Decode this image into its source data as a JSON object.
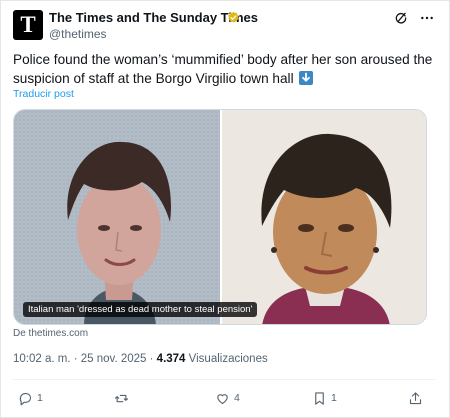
{
  "author": {
    "avatar_letter": "T",
    "name": "The Times and The Sunday Times",
    "handle": "@thetimes",
    "verified_color": "#e2b719"
  },
  "tweet": {
    "text": "Police found the woman’s ‘mummified’ body after her son aroused the suspicion of staff at the Borgo Virgilio town hall",
    "emoji": "down-arrow-emoji",
    "translate_label": "Traducir post"
  },
  "media": {
    "caption": "Italian man 'dressed as dead mother to steal pension'",
    "source": "De thetimes.com",
    "left_photo": "woman-passport-photo",
    "right_photo": "man-in-disguise-photo"
  },
  "meta": {
    "time": "10:02 a. m.",
    "date": "25 nov. 2025",
    "views": "4.374",
    "views_label": "Visualizaciones"
  },
  "actions": {
    "reply_count": "1",
    "retweet_count": "",
    "like_count": "4",
    "bookmark_count": "1"
  },
  "colors": {
    "text": "#0f1419",
    "secondary": "#536471",
    "link": "#1d9bf0",
    "emoji_blue": "#3b88c3"
  },
  "icons": [
    "verified-badge-icon",
    "grok-icon",
    "more-icon",
    "reply-icon",
    "retweet-icon",
    "like-icon",
    "bookmark-icon",
    "share-icon"
  ]
}
